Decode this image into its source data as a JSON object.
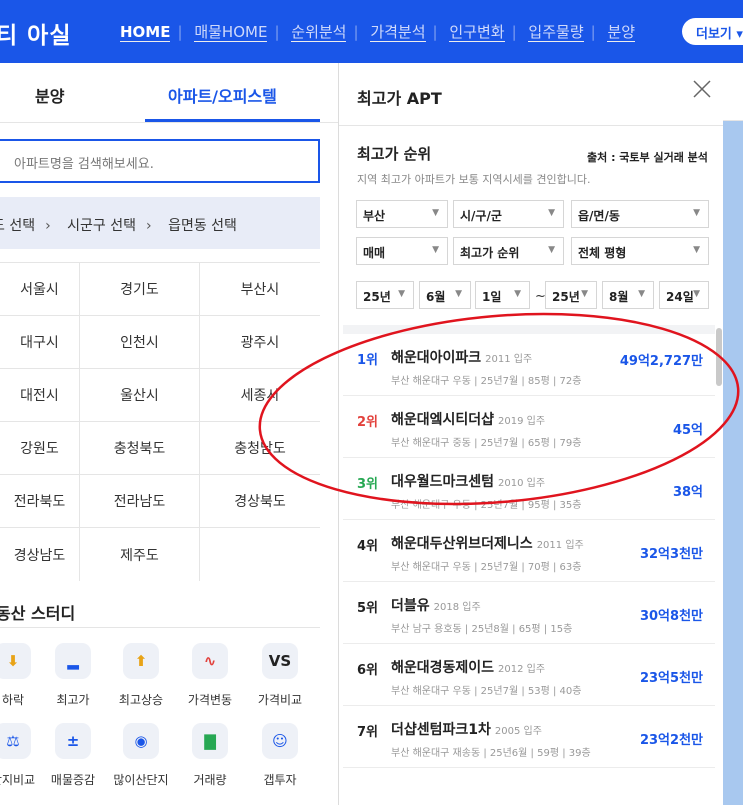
{
  "nav": {
    "brand": "티 아실",
    "links": [
      "HOME",
      "매물HOME",
      "순위분석",
      "가격분석",
      "인구변화",
      "입주물량",
      "분양"
    ],
    "more": "더보기",
    "colors": {
      "bar": "#1a56e8"
    }
  },
  "left": {
    "tabs": {
      "sale": "분양",
      "apt": "아파트/오피스텔"
    },
    "search_placeholder": "아파트명을 검색해보세요.",
    "region_steps": [
      "도 선택",
      "시군구 선택",
      "읍면동 선택"
    ],
    "regions": [
      [
        "서울시",
        "경기도",
        "부산시"
      ],
      [
        "대구시",
        "인천시",
        "광주시"
      ],
      [
        "대전시",
        "울산시",
        "세종시"
      ],
      [
        "강원도",
        "충청북도",
        "충청남도"
      ],
      [
        "전라북도",
        "전라남도",
        "경상북도"
      ],
      [
        "경상남도",
        "제주도",
        ""
      ]
    ],
    "study_title": "동산 스터디",
    "tools": [
      {
        "label": "하락",
        "icon": "down-icon",
        "glyph": "⬇",
        "color": "yellow"
      },
      {
        "label": "최고가",
        "icon": "bar-icon",
        "glyph": "▂",
        "color": "blue"
      },
      {
        "label": "최고상승",
        "icon": "up-icon",
        "glyph": "⬆",
        "color": "yellow"
      },
      {
        "label": "가격변동",
        "icon": "pulse-icon",
        "glyph": "∿",
        "color": "red"
      },
      {
        "label": "가격비교",
        "icon": "vs-icon",
        "glyph": "VS",
        "color": "black"
      },
      {
        "label": "단지비교",
        "icon": "scale-icon",
        "glyph": "⚖",
        "color": "blue"
      },
      {
        "label": "매물증감",
        "icon": "plusminus-icon",
        "glyph": "±",
        "color": "blue"
      },
      {
        "label": "많이산단지",
        "icon": "pin-icon",
        "glyph": "◉",
        "color": "blue"
      },
      {
        "label": "거래량",
        "icon": "chart-icon",
        "glyph": "▇",
        "color": "green"
      },
      {
        "label": "갭투자",
        "icon": "user-icon",
        "glyph": "☺",
        "color": "blue"
      }
    ]
  },
  "right": {
    "title": "최고가 APT",
    "rank_title": "최고가 순위",
    "source": "출처 : 국토부 실거래 분석",
    "desc": "지역 최고가 아파트가 보통 지역시세를 견인합니다.",
    "filters": {
      "sido": "부산",
      "sigungu": "시/구/군",
      "dong": "읍/면/동",
      "trade": "매매",
      "sort": "최고가 순위",
      "size": "전체 평형",
      "from_year": "25년",
      "from_month": "6월",
      "from_day": "1일",
      "tilde": "~",
      "to_year": "25년",
      "to_month": "8월",
      "to_day": "24일"
    },
    "items": [
      {
        "rank": "1위",
        "name": "해운대아이파크",
        "year": "2011 입주",
        "detail": "부산 해운대구 우동 | 25년7월 | 85평 | 72층",
        "price": "49억2,727만",
        "rank_color": "#1a56e8"
      },
      {
        "rank": "2위",
        "name": "해운대엨시티더샵",
        "year": "2019 입주",
        "detail": "부산 해운대구 중동 | 25년7월 | 65평 | 79층",
        "price": "45억",
        "rank_color": "#e2413c"
      },
      {
        "rank": "3위",
        "name": "대우월드마크센텀",
        "year": "2010 입주",
        "detail": "부산 해운대구 우동 | 25년7월 | 95평 | 35층",
        "price": "38억",
        "rank_color": "#27a853"
      },
      {
        "rank": "4위",
        "name": "해운대두산위브더제니스",
        "year": "2011 입주",
        "detail": "부산 해운대구 우동 | 25년7월 | 70평 | 63층",
        "price": "32억3천만",
        "rank_color": "#222222"
      },
      {
        "rank": "5위",
        "name": "더블유",
        "year": "2018 입주",
        "detail": "부산 남구 용호동 | 25년8월 | 65평 | 15층",
        "price": "30억8천만",
        "rank_color": "#222222"
      },
      {
        "rank": "6위",
        "name": "해운대경동제이드",
        "year": "2012 입주",
        "detail": "부산 해운대구 우동 | 25년7월 | 53평 | 40층",
        "price": "23억5천만",
        "rank_color": "#222222"
      },
      {
        "rank": "7위",
        "name": "더샵센텀파크1차",
        "year": "2005 입주",
        "detail": "부산 해운대구 재송동 | 25년6월 | 59평 | 39층",
        "price": "23억2천만",
        "rank_color": "#222222"
      }
    ],
    "highlight_color": "#e0141e"
  }
}
